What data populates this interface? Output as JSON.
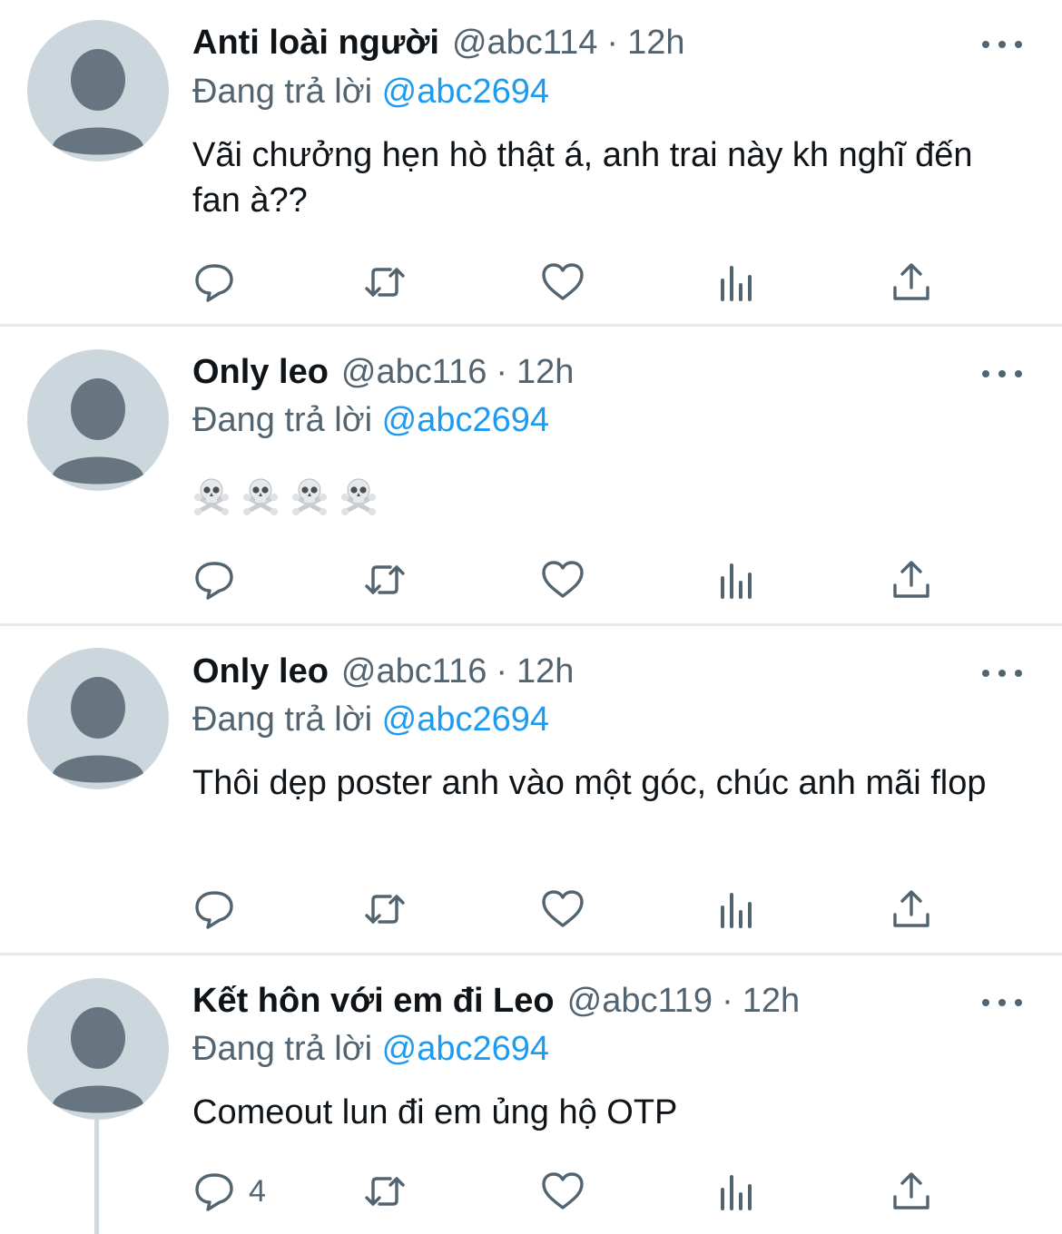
{
  "tweets": [
    {
      "name": "Anti loài người",
      "handle": "@abc114",
      "time": "12h",
      "reply_prefix": "Đang trả lời",
      "reply_to": "@abc2694",
      "body": "Vãi chưởng hẹn hò thật á, anh trai này kh nghĩ đến fan à??",
      "reply_count": ""
    },
    {
      "name": "Only leo",
      "handle": "@abc116",
      "time": "12h",
      "reply_prefix": "Đang trả lời",
      "reply_to": "@abc2694",
      "body": "",
      "emoji": [
        "☠️",
        "☠️",
        "☠️",
        "☠️"
      ],
      "reply_count": ""
    },
    {
      "name": "Only leo",
      "handle": "@abc116",
      "time": "12h",
      "reply_prefix": "Đang trả lời",
      "reply_to": "@abc2694",
      "body": "Thôi dẹp poster anh vào một góc, chúc anh mãi flop",
      "reply_count": ""
    },
    {
      "name": "Kết hôn với em đi Leo",
      "handle": "@abc119",
      "time": "12h",
      "reply_prefix": "Đang trả lời",
      "reply_to": "@abc2694",
      "body": "Comeout lun đi em ủng hộ OTP",
      "reply_count": "4"
    }
  ],
  "separator": "·",
  "icons": {
    "avatar": "default-avatar-icon",
    "more": "more-options-icon",
    "reply": "reply-icon",
    "retweet": "retweet-icon",
    "like": "heart-icon",
    "analytics": "analytics-icon",
    "share": "share-icon"
  },
  "colors": {
    "accent": "#1d9bf0",
    "secondary_text": "#536471",
    "avatar_bg": "#ccd6dd",
    "avatar_fg": "#66757f",
    "divider": "#e6e9ec"
  }
}
